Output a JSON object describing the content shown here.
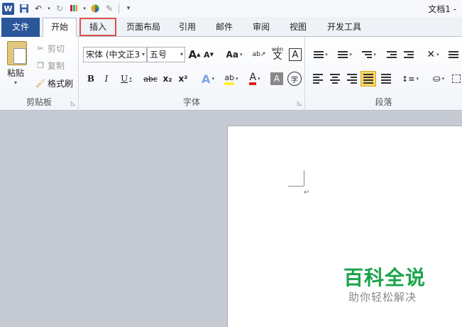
{
  "window": {
    "title": "文档1 - ",
    "app_logo": "W"
  },
  "quick_access": [
    "save-icon",
    "undo-icon",
    "redo-icon",
    "format-painter-icon",
    "color-icon",
    "pen-icon",
    "customize-icon"
  ],
  "tabs": [
    {
      "label": "文件"
    },
    {
      "label": "开始"
    },
    {
      "label": "插入"
    },
    {
      "label": "页面布局"
    },
    {
      "label": "引用"
    },
    {
      "label": "邮件"
    },
    {
      "label": "审阅"
    },
    {
      "label": "视图"
    },
    {
      "label": "开发工具"
    }
  ],
  "clipboard": {
    "group_label": "剪贴板",
    "paste_label": "粘贴",
    "cut_label": "剪切",
    "copy_label": "复制",
    "format_painter_label": "格式刷"
  },
  "font": {
    "group_label": "字体",
    "font_name": "宋体 (中文正3",
    "font_size": "五号",
    "grow": "A",
    "shrink": "A",
    "case": "Aa",
    "phonetic": "wén",
    "phonetic_char": "文",
    "border_char": "A",
    "bold": "B",
    "italic": "I",
    "underline": "U",
    "strike": "abc",
    "sub": "x₂",
    "sup": "x²",
    "text_effect": "A",
    "highlight": "ab",
    "font_color": "A",
    "shade_char": "A",
    "enclose_char": "字"
  },
  "paragraph": {
    "group_label": "段落"
  },
  "watermark": {
    "title": "百科全说",
    "subtitle": "助你轻松解决"
  },
  "colors": {
    "file_tab": "#2b579a",
    "insert_highlight": "#d9534f",
    "watermark": "#1aa44a"
  }
}
